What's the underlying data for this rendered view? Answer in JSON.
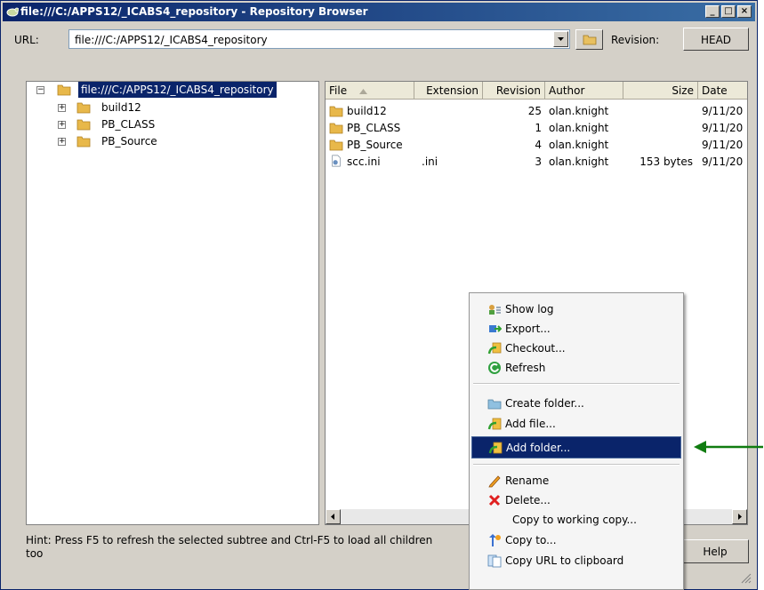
{
  "window": {
    "title": "file:///C:/APPS12/_ICABS4_repository - Repository Browser",
    "controls": [
      "_",
      "□",
      "×"
    ]
  },
  "toolbar": {
    "url_label": "URL:",
    "url_value": "file:///C:/APPS12/_ICABS4_repository",
    "revision_label": "Revision:",
    "revision_button": "HEAD"
  },
  "tree": {
    "root": "file:///C:/APPS12/_ICABS4_repository",
    "children": [
      "build12",
      "PB_CLASS",
      "PB_Source"
    ]
  },
  "file_list": {
    "columns": [
      "File",
      "Extension",
      "Revision",
      "Author",
      "Size",
      "Date"
    ],
    "rows": [
      {
        "file": "build12",
        "extension": "",
        "revision": "25",
        "author": "olan.knight",
        "size": "",
        "date": "9/11/20"
      },
      {
        "file": "PB_CLASS",
        "extension": "",
        "revision": "1",
        "author": "olan.knight",
        "size": "",
        "date": "9/11/20"
      },
      {
        "file": "PB_Source",
        "extension": "",
        "revision": "4",
        "author": "olan.knight",
        "size": "",
        "date": "9/11/20"
      },
      {
        "file": "scc.ini",
        "extension": ".ini",
        "revision": "3",
        "author": "olan.knight",
        "size": "153 bytes",
        "date": "9/11/20"
      }
    ]
  },
  "hint": "Hint: Press F5 to refresh the selected subtree and Ctrl-F5 to load all children too",
  "help_button": "Help",
  "context_menu": {
    "items": [
      {
        "label": "Show log",
        "icon": "show-log-icon"
      },
      {
        "label": "Export...",
        "icon": "export-icon"
      },
      {
        "label": "Checkout...",
        "icon": "checkout-icon"
      },
      {
        "label": "Refresh",
        "icon": "refresh-icon"
      },
      {
        "label": "Create folder...",
        "icon": "create-folder-icon"
      },
      {
        "label": "Add file...",
        "icon": "add-file-icon"
      },
      {
        "label": "Add folder...",
        "icon": "add-folder-icon",
        "highlighted": true
      },
      {
        "label": "Rename",
        "icon": "rename-icon"
      },
      {
        "label": "Delete...",
        "icon": "delete-icon"
      },
      {
        "label": "Copy to working copy...",
        "icon": ""
      },
      {
        "label": "Copy to...",
        "icon": "copy-to-icon"
      },
      {
        "label": "Copy URL to clipboard",
        "icon": "copy-url-icon"
      }
    ]
  },
  "colors": {
    "title_bar": "#0a246a",
    "selection": "#0a246a",
    "annotation_arrow": "#107c10",
    "folder": "#e8b84a"
  }
}
